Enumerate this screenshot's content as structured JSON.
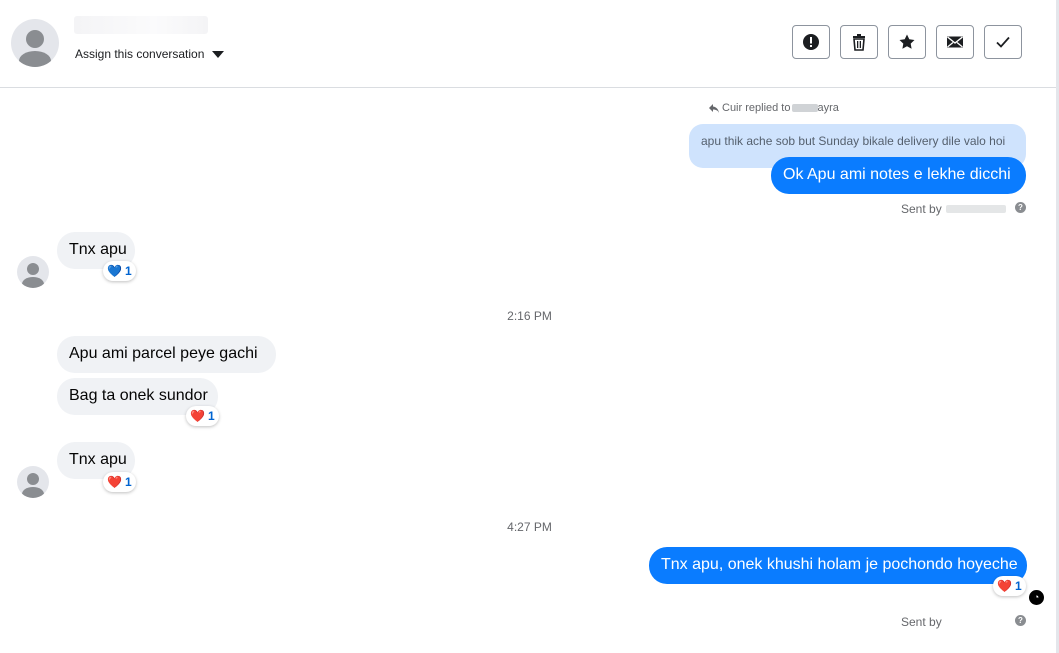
{
  "header": {
    "assign_label": "Assign this conversation",
    "buttons": [
      {
        "name": "report-button",
        "icon": "alert-icon"
      },
      {
        "name": "delete-button",
        "icon": "trash-icon"
      },
      {
        "name": "star-button",
        "icon": "star-icon"
      },
      {
        "name": "mark-unread-button",
        "icon": "envelope-icon"
      },
      {
        "name": "mark-done-button",
        "icon": "check-icon"
      }
    ]
  },
  "thread": {
    "reply_note": {
      "prefix": "Cuir replied to",
      "suffix": "ayra"
    },
    "quoted_text": "apu thik ache sob but Sunday bikale delivery dile valo hoi",
    "messages": [
      {
        "direction": "out",
        "text": "Ok Apu ami notes e  lekhe dicchi"
      },
      {
        "direction": "in",
        "text": "Tnx apu",
        "reaction": {
          "emoji": "💙",
          "count": "1"
        }
      },
      {
        "direction": "in",
        "text": "Apu ami  parcel  peye gachi"
      },
      {
        "direction": "in",
        "text": "Bag ta onek sundor",
        "reaction": {
          "emoji": "❤️",
          "count": "1"
        }
      },
      {
        "direction": "in",
        "text": "Tnx apu",
        "reaction": {
          "emoji": "❤️",
          "count": "1"
        }
      },
      {
        "direction": "out",
        "text": "Tnx apu, onek khushi holam je pochondo hoyeche",
        "reaction": {
          "emoji": "❤️",
          "count": "1"
        }
      }
    ],
    "timestamps": [
      "2:16 PM",
      "4:27 PM"
    ],
    "sent_by_label": "Sent by",
    "help_glyph": "?"
  },
  "colors": {
    "outgoing": "#0a7cff",
    "incoming": "#f0f2f5",
    "quoted": "#cfe3fd"
  }
}
